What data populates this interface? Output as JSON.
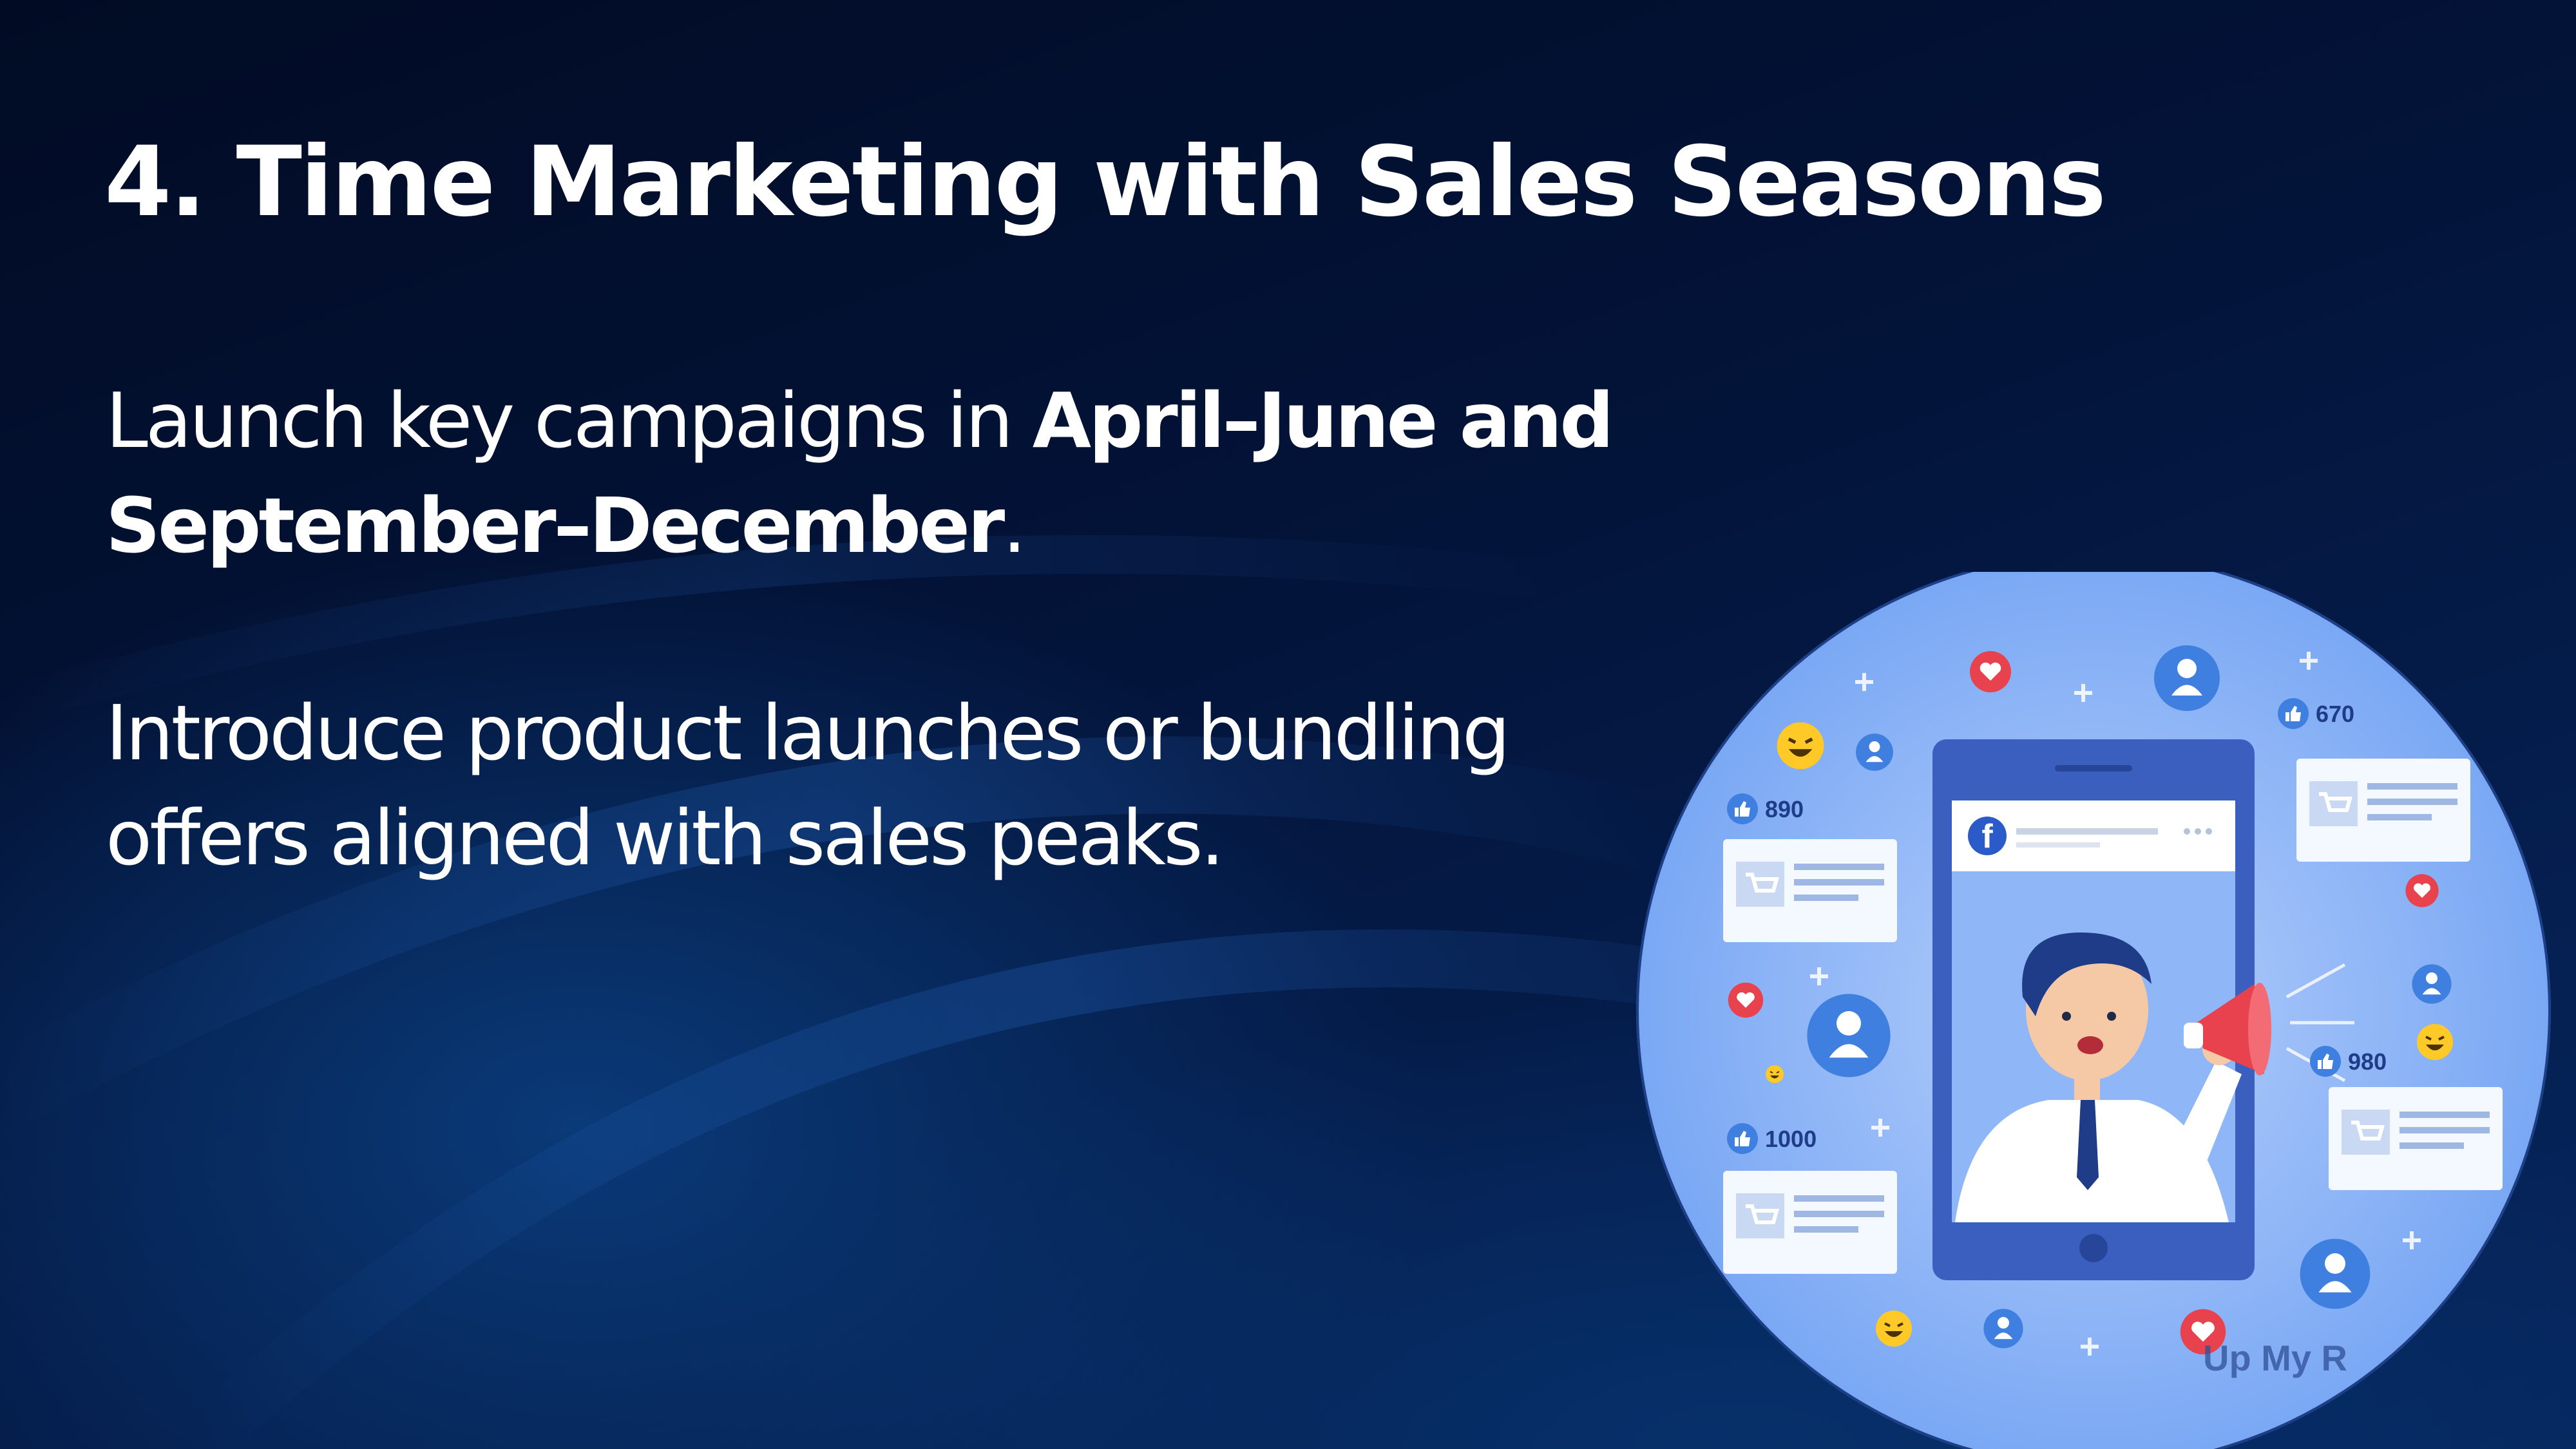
{
  "slide": {
    "title": "4. Time Marketing with Sales Seasons",
    "paragraph1": {
      "prefix": "Launch key campaigns in ",
      "bold": "April–June and September–December",
      "suffix": "."
    },
    "paragraph2": "Introduce product launches or bundling offers aligned with sales peaks."
  },
  "illustration": {
    "like_counts": [
      "890",
      "670",
      "980",
      "1000"
    ],
    "watermark": "Up My R",
    "facebook_letter": "f"
  },
  "colors": {
    "background": "#03143a",
    "circle": "#7aa8f4",
    "phone": "#3b5fbe",
    "screen": "#8fb6f7",
    "heart": "#e8424f",
    "megaphone": "#e8424f"
  },
  "icons": [
    "heart-icon",
    "user-icon",
    "thumbs-up-icon",
    "laugh-emoji-icon",
    "plus-icon",
    "facebook-icon",
    "megaphone-icon",
    "cart-icon"
  ]
}
